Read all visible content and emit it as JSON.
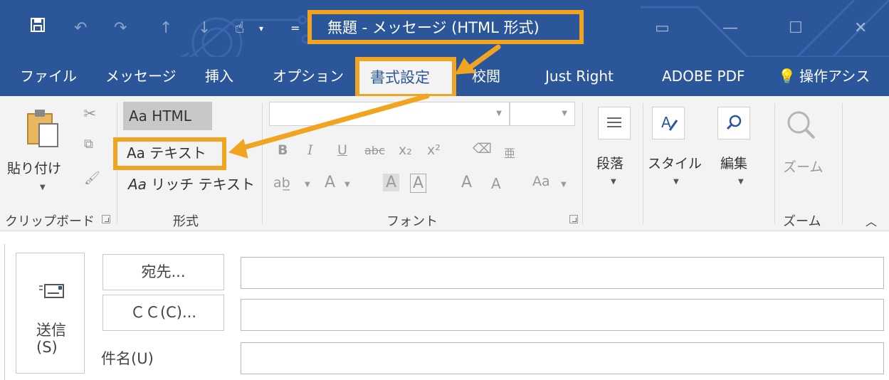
{
  "window": {
    "title": "無題 - メッセージ (HTML 形式)"
  },
  "quick_access": {
    "icons": [
      "save-icon",
      "undo-icon",
      "redo-icon",
      "up-icon",
      "down-icon",
      "touch-mode-icon",
      "customize-icon"
    ]
  },
  "tabs": [
    {
      "label": "ファイル"
    },
    {
      "label": "メッセージ"
    },
    {
      "label": "挿入"
    },
    {
      "label": "オプション"
    },
    {
      "label": "書式設定"
    },
    {
      "label": "校閲"
    },
    {
      "label": "Just Right"
    },
    {
      "label": "ADOBE PDF"
    },
    {
      "label": "操作アシス"
    }
  ],
  "ribbon": {
    "clipboard": {
      "paste_label": "貼り付け",
      "group_label": "クリップボード"
    },
    "format": {
      "html_label": "Aa HTML",
      "text_prefix": "Aa",
      "text_label": "テキスト",
      "rich_prefix": "Aa",
      "rich_label": "リッチ テキスト",
      "group_label": "形式"
    },
    "font": {
      "bold": "B",
      "italic": "I",
      "underline": "U",
      "strike": "abc",
      "subscript": "x₂",
      "superscript": "x²",
      "ruby": "亜",
      "font_color": "A",
      "shading": "A",
      "border_char": "A",
      "grow": "A",
      "shrink": "A",
      "case": "Aa",
      "group_label": "フォント"
    },
    "paragraph_label": "段落",
    "style_label": "スタイル",
    "edit_label": "編集",
    "zoom": {
      "button_label": "ズーム",
      "group_label": "ズーム"
    }
  },
  "message": {
    "send_label": "送信",
    "send_shortcut": "(S)",
    "to_button": "宛先...",
    "cc_button": "ＣＣ(C)...",
    "subject_label": "件名(U)",
    "to_value": "",
    "cc_value": "",
    "subject_value": ""
  },
  "colors": {
    "titlebar": "#2b579a",
    "ribbon": "#f3f3f3",
    "highlight": "#f0a420"
  }
}
